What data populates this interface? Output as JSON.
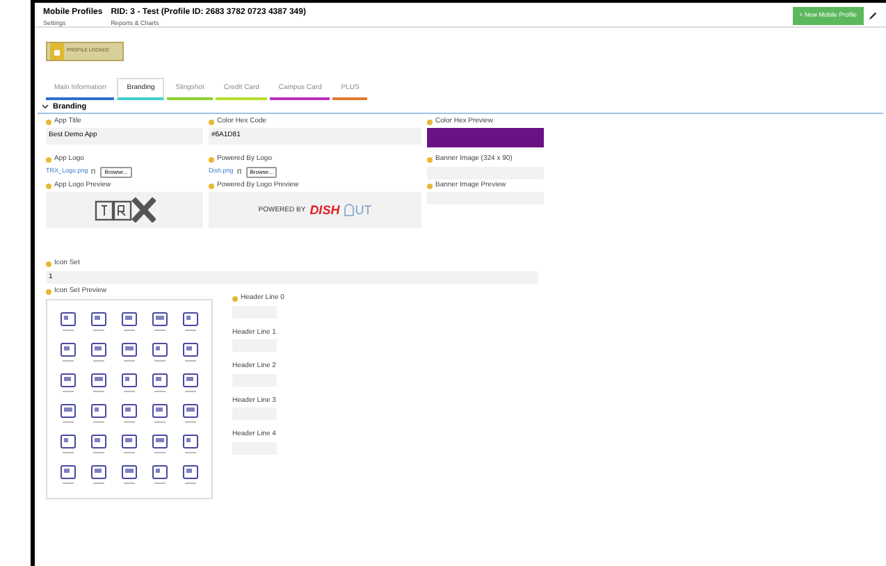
{
  "header": {
    "title": "Mobile Profiles",
    "subtitle": "RID: 3 - Test (Profile ID: 2683 3782 0723 4387 349)",
    "links": [
      "Settings",
      "Reports & Charts"
    ],
    "new_button": "+ New Mobile Profile"
  },
  "locked_badge": {
    "label": "PROFILE LOCKED"
  },
  "tabs": [
    {
      "label": "Main Information",
      "selected": false,
      "color": "#2f6fd0"
    },
    {
      "label": "Branding",
      "selected": true,
      "color": "#3fd0d0"
    },
    {
      "label": "Slingshot",
      "selected": false,
      "color": "#8cd02f"
    },
    {
      "label": "Credit Card",
      "selected": false,
      "color": "#b8e02f"
    },
    {
      "label": "Campus Card",
      "selected": false,
      "color": "#c02fc0"
    },
    {
      "label": "PLUS",
      "selected": false,
      "color": "#e07a2f"
    }
  ],
  "section": {
    "title": "Branding",
    "expanded": true
  },
  "fields": {
    "app_title": {
      "label": "App Title",
      "value": "Best Demo App"
    },
    "color_hex_code": {
      "label": "Color Hex Code",
      "value": "#6A1D81"
    },
    "color_hex_preview": {
      "label": "Color Hex Preview",
      "color": "#6a1283"
    },
    "app_logo": {
      "label": "App Logo",
      "file": "TRX_Logo.png",
      "button": "Browse..."
    },
    "powered_by_logo": {
      "label": "Powered By Logo",
      "file": "Dish.png",
      "button": "Browse..."
    },
    "banner_image": {
      "label": "Banner Image (324 x 90)"
    },
    "app_logo_preview": {
      "label": "App Logo Preview"
    },
    "powered_by_logo_preview": {
      "label": "Powered By Logo Preview",
      "powered_text": "POWERED BY",
      "brand_left": "DISH",
      "brand_right": "UT"
    },
    "banner_image_preview": {
      "label": "Banner Image Preview"
    },
    "icon_set": {
      "label": "Icon Set",
      "value": "1"
    },
    "icon_set_preview": {
      "label": "Icon Set Preview"
    }
  },
  "header_lines": [
    {
      "label": "Header Line 0",
      "required": true
    },
    {
      "label": "Header Line 1",
      "required": false
    },
    {
      "label": "Header Line 2",
      "required": false
    },
    {
      "label": "Header Line 3",
      "required": false
    },
    {
      "label": "Header Line 4",
      "required": false
    }
  ]
}
